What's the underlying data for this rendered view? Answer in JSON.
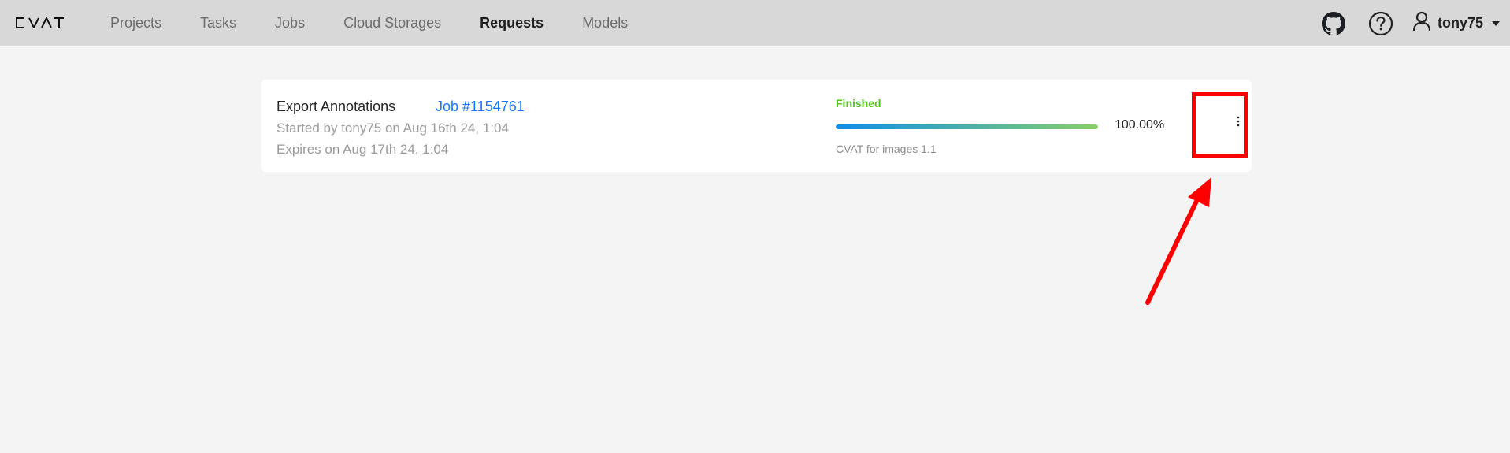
{
  "header": {
    "logo_text": "CVAT",
    "nav": [
      {
        "label": "Projects"
      },
      {
        "label": "Tasks"
      },
      {
        "label": "Jobs"
      },
      {
        "label": "Cloud Storages"
      },
      {
        "label": "Requests",
        "active": true
      },
      {
        "label": "Models"
      }
    ],
    "user": {
      "name": "tony75"
    }
  },
  "request": {
    "title": "Export Annotations",
    "job_link": "Job #1154761",
    "started": "Started by tony75 on Aug 16th 24, 1:04",
    "expires": "Expires on Aug 17th 24, 1:04",
    "status": "Finished",
    "progress": 1.0,
    "progress_text": "100.00%",
    "format": "CVAT for images 1.1"
  },
  "colors": {
    "status": "#52c41a",
    "link": "#1677ff",
    "annotation": "#ff0000"
  },
  "icons": {
    "github": "github-icon",
    "help": "question-circle-icon",
    "user": "user-icon",
    "caret": "caret-down-icon",
    "more": "more-vertical-icon"
  }
}
